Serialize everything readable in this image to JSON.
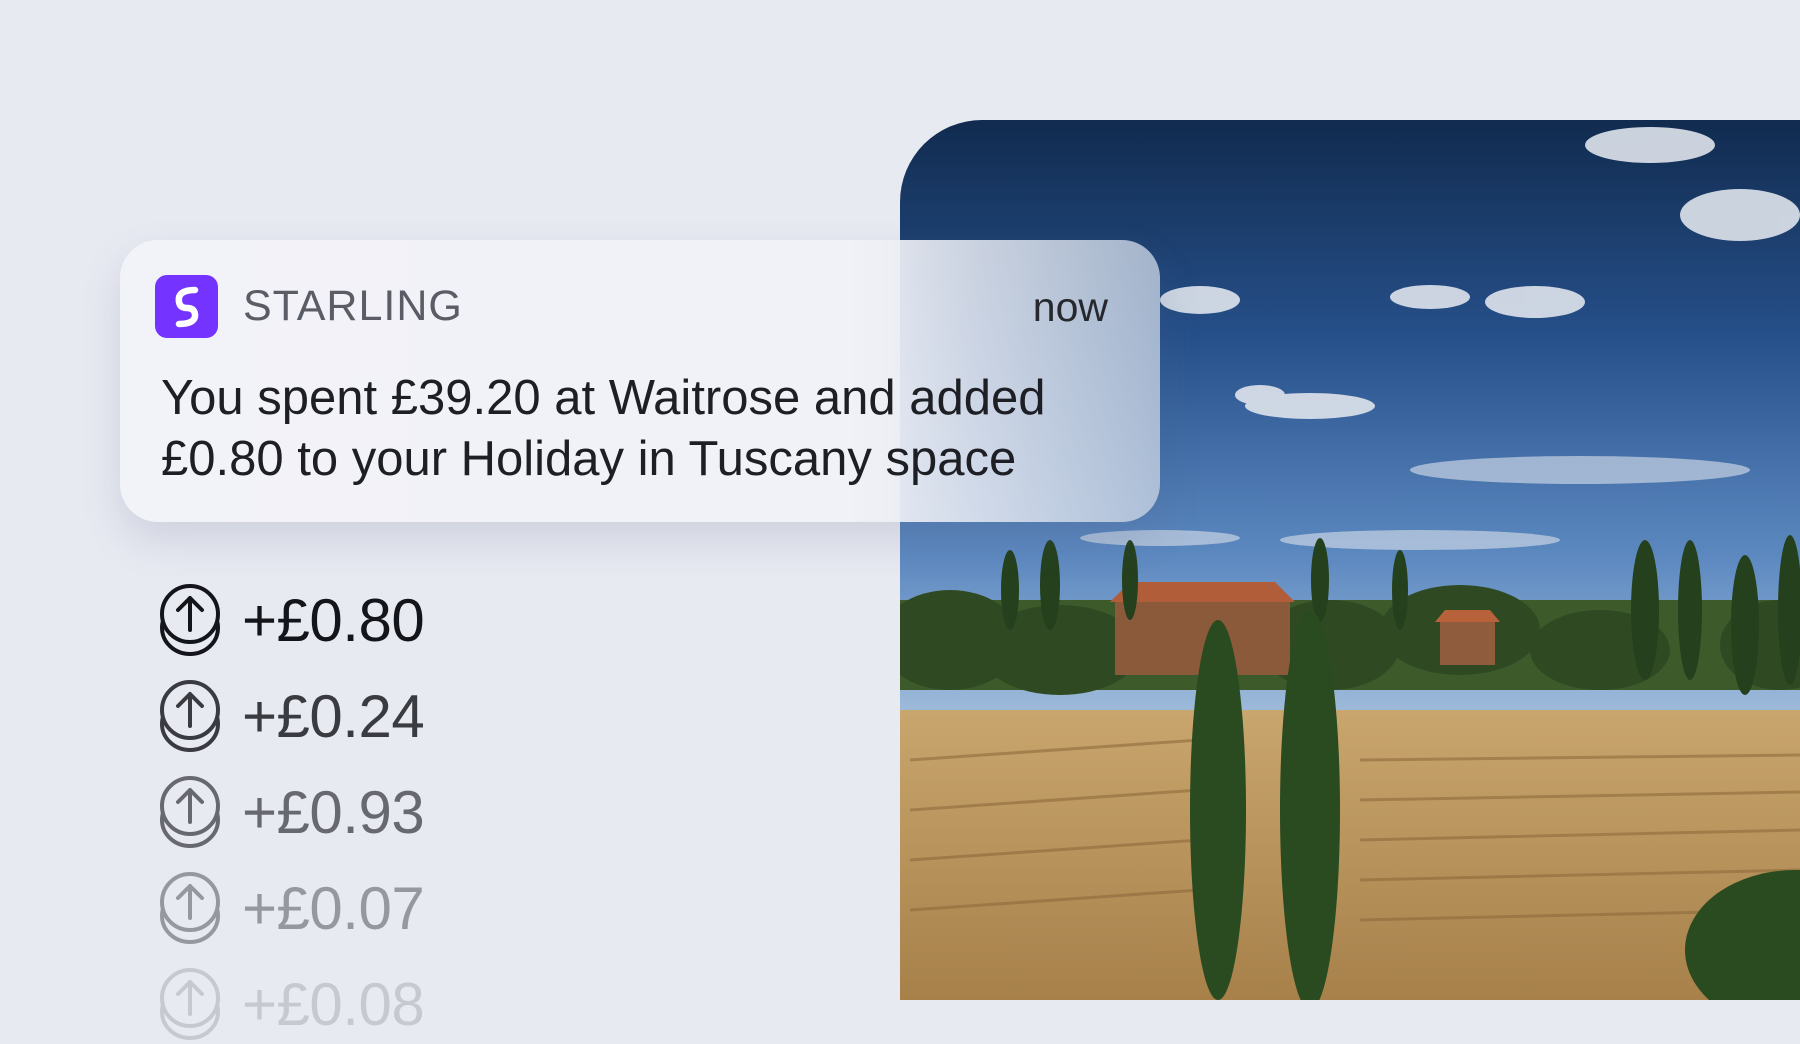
{
  "notification": {
    "app_name": "STARLING",
    "app_icon": "starling-logo-icon",
    "time": "now",
    "message": "You spent £39.20 at Waitrose and added £0.80 to your Holiday in Tuscany space"
  },
  "roundups": [
    {
      "amount": "+£0.80",
      "opacity": 1.0
    },
    {
      "amount": "+£0.24",
      "opacity": 0.82
    },
    {
      "amount": "+£0.93",
      "opacity": 0.6
    },
    {
      "amount": "+£0.07",
      "opacity": 0.38
    },
    {
      "amount": "+£0.08",
      "opacity": 0.15
    }
  ],
  "roundup_icon": "coin-stack-arrow-up-icon",
  "photo": {
    "subject": "tuscany-landscape"
  },
  "colors": {
    "accent": "#7433ff",
    "background": "#e8eaf2"
  }
}
